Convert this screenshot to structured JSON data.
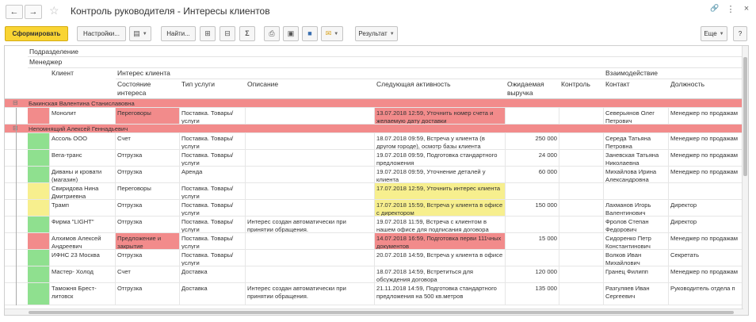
{
  "window": {
    "title": "Контроль руководителя - Интересы клиентов",
    "back_icon": "←",
    "forward_icon": "→",
    "star_icon": "☆",
    "link_icon": "🔗",
    "menu_icon": "⋮",
    "close_icon": "×"
  },
  "toolbar": {
    "generate": "Сформировать",
    "settings": "Настройки...",
    "find": "Найти...",
    "sum": "Σ",
    "result": "Результат",
    "more": "Еще",
    "help": "?"
  },
  "headers": {
    "subdivision": "Подразделение",
    "manager": "Менеджер",
    "client": "Клиент",
    "client_interest": "Интерес клиента",
    "interest_state": "Состояние интереса",
    "service_type": "Тип услуги",
    "description": "Описание",
    "next_activity": "Следующая активность",
    "expected_revenue": "Ожидаемая выручка",
    "control": "Контроль",
    "interaction": "Взаимодействие",
    "contact": "Контакт",
    "position": "Должность"
  },
  "groups": [
    {
      "name": "Бакинская Валентина Станиславовна"
    },
    {
      "name": "Непомнящий Алексей Геннадьевич"
    }
  ],
  "rows": [
    {
      "status_color": "#f28b8b",
      "client": "Монолит",
      "state": "Переговоры",
      "state_color": "#f28b8b",
      "service": "Поставка. Товары/услуги",
      "description": "",
      "activity": "13.07.2018 12:59, Уточнить номер счета и желаемую дату доставки",
      "activity_color": "#f28b8b",
      "revenue": "",
      "control": "",
      "contact": "Северьянов Олег Петрович",
      "position": "Менеджер по продажам"
    },
    {
      "status_color": "#8fe08f",
      "client": "Ассоль ООО",
      "state": "Счет",
      "state_color": "",
      "service": "Поставка. Товары/услуги",
      "description": "",
      "activity": "18.07.2018 09:59, Встреча у клиента (в другом городе), осмотр базы клиента",
      "activity_color": "",
      "revenue": "250 000",
      "control": "",
      "contact": "Середа Татьяна Петровна",
      "position": "Менеджер по продажам"
    },
    {
      "status_color": "#8fe08f",
      "client": "Вега-транс",
      "state": "Отгрузка",
      "state_color": "",
      "service": "Поставка. Товары/услуги",
      "description": "",
      "activity": "19.07.2018 09:59, Подготовка стандартного предложения",
      "activity_color": "",
      "revenue": "24 000",
      "control": "",
      "contact": "Заневская Татьяна Николаевна",
      "position": "Менеджер по продажам"
    },
    {
      "status_color": "#8fe08f",
      "client": "Диваны и кровати (магазин)",
      "state": "Отгрузка",
      "state_color": "",
      "service": "Аренда",
      "description": "",
      "activity": "19.07.2018 09:59, Уточнение деталей у клиента",
      "activity_color": "",
      "revenue": "60 000",
      "control": "",
      "contact": "Михайлова Ирина Александровна",
      "position": "Менеджер по продажам"
    },
    {
      "status_color": "#f7ef8e",
      "client": "Свиридова Нина Дмитриевна",
      "state": "Переговоры",
      "state_color": "",
      "service": "Поставка. Товары/услуги",
      "description": "",
      "activity": "17.07.2018 12:59, Уточнить интерес клиента",
      "activity_color": "#f7ef8e",
      "revenue": "",
      "control": "",
      "contact": "",
      "position": ""
    },
    {
      "status_color": "#f7ef8e",
      "client": "Трамп",
      "state": "Отгрузка",
      "state_color": "",
      "service": "Поставка. Товары/услуги",
      "description": "",
      "activity": "17.07.2018 15:59, Встреча у клиента в офисе с директором",
      "activity_color": "#f7ef8e",
      "revenue": "150 000",
      "control": "",
      "contact": "Лахманов Игорь Валентинович",
      "position": "Директор"
    },
    {
      "status_color": "#8fe08f",
      "client": "Фирма \"LIGHT\"",
      "state": "Отгрузка",
      "state_color": "",
      "service": "Поставка. Товары/услуги",
      "description": "Интерес создан автоматически при принятии обращения.",
      "activity": "19.07.2018 11:59, Встреча с клиентом в нашем офисе для подписания договора",
      "activity_color": "",
      "revenue": "",
      "control": "",
      "contact": "Фролов Степан Федорович",
      "position": "Директор"
    },
    {
      "status_color": "#f28b8b",
      "client": "Алхимов Алексей Андреевич",
      "state": "Предложение и закрытие",
      "state_color": "#f28b8b",
      "service": "Поставка. Товары/услуги",
      "description": "",
      "activity": "14.07.2018 16:59, Подготовка перви 111чных документов",
      "activity_color": "#f28b8b",
      "revenue": "15 000",
      "control": "",
      "contact": "Сидоренко Петр Константинович",
      "position": "Менеджер по продажам"
    },
    {
      "status_color": "#8fe08f",
      "client": "ИФНС 23 Москва",
      "state": "Отгрузка",
      "state_color": "",
      "service": "Поставка. Товары/услуги",
      "description": "",
      "activity": "20.07.2018 14:59, Встреча у клиента в офисе",
      "activity_color": "",
      "revenue": "",
      "control": "",
      "contact": "Волков Иван Михайлович",
      "position": "Секретать"
    },
    {
      "status_color": "#8fe08f",
      "client": "Мастер- Холод",
      "state": "Счет",
      "state_color": "",
      "service": "Доставка",
      "description": "",
      "activity": "18.07.2018 14:59, Встретиться для обсуждения договора",
      "activity_color": "",
      "revenue": "120 000",
      "control": "",
      "contact": "Гранец Филипп",
      "position": "Менеджер по продажам"
    },
    {
      "status_color": "#8fe08f",
      "client": "Таможня Брест-литовск",
      "state": "Отгрузка",
      "state_color": "",
      "service": "Доставка",
      "description": "Интерес создан автоматически при принятии обращения.",
      "activity": "21.11.2018 14:59, Подготовка стандартного предложения на 500 кв.метров",
      "activity_color": "",
      "revenue": "135 000",
      "control": "",
      "contact": "Разгуляев Иван Сергеевич",
      "position": "Руководитель отдела п"
    }
  ]
}
